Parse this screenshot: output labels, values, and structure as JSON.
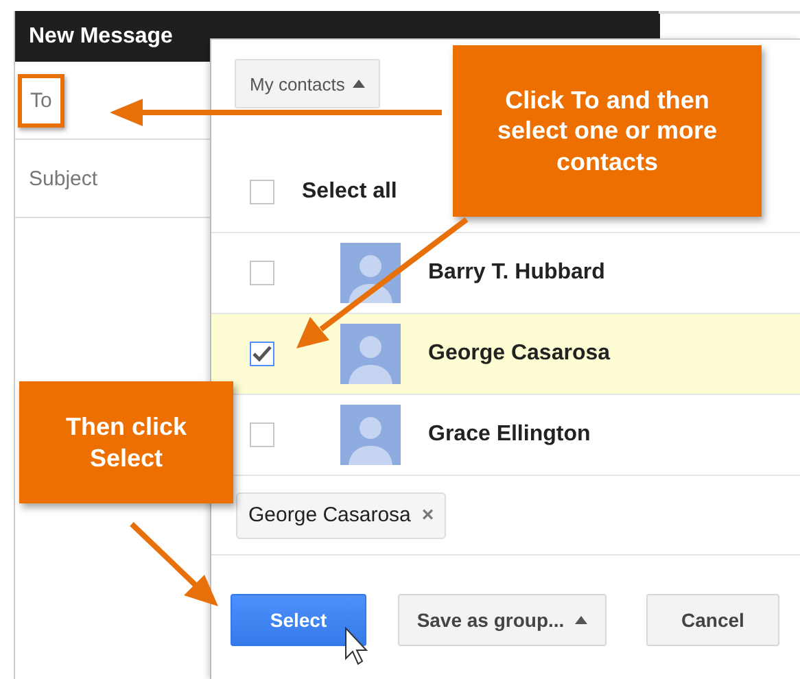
{
  "compose": {
    "title": "New Message",
    "fields": [
      {
        "label": "To",
        "highlighted": true
      },
      {
        "label": "Subject",
        "highlighted": false
      }
    ]
  },
  "dialog": {
    "source_button": {
      "label": "My contacts"
    },
    "select_all": {
      "label": "Select all",
      "checked": false
    },
    "contacts": [
      {
        "name": "Barry T. Hubbard",
        "checked": false
      },
      {
        "name": "George Casarosa",
        "checked": true
      },
      {
        "name": "Grace Ellington",
        "checked": false
      }
    ],
    "chips": [
      {
        "label": "George Casarosa",
        "remove": "×"
      }
    ],
    "buttons": [
      {
        "label": "Select",
        "kind": "primary"
      },
      {
        "label": "Save as group...",
        "kind": "menu"
      },
      {
        "label": "Cancel",
        "kind": "plain"
      }
    ]
  },
  "callouts": [
    {
      "text": "Click To and then select one or more contacts"
    },
    {
      "text": "Then click Select"
    }
  ]
}
